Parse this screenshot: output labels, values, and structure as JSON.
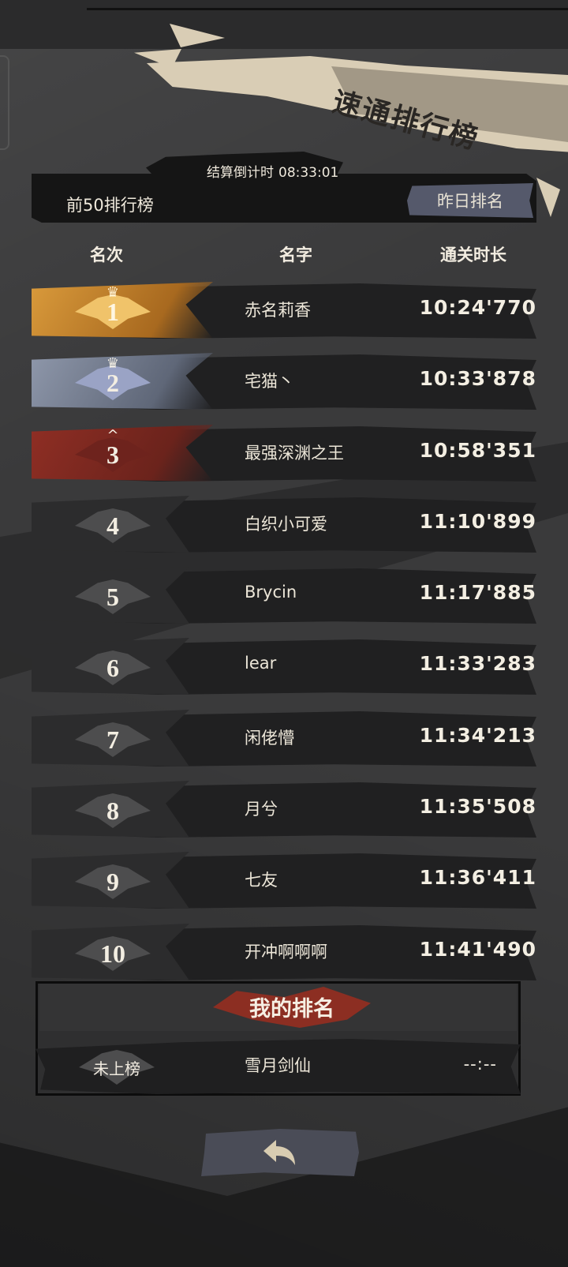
{
  "title": "速通排行榜",
  "countdown": {
    "label": "结算倒计时",
    "time": "08:33:01"
  },
  "board_label": "前50排行榜",
  "yesterday_button": "昨日排名",
  "columns": {
    "rank": "名次",
    "name": "名字",
    "time": "通关时长"
  },
  "entries": [
    {
      "rank": "1",
      "name": "赤名莉香",
      "time": "10:24'770",
      "tier": "gold"
    },
    {
      "rank": "2",
      "name": "宅猫丶",
      "time": "10:33'878",
      "tier": "silver"
    },
    {
      "rank": "3",
      "name": "最强深渊之王",
      "time": "10:58'351",
      "tier": "bronze"
    },
    {
      "rank": "4",
      "name": "白织小可爱",
      "time": "11:10'899",
      "tier": "normal"
    },
    {
      "rank": "5",
      "name": "Brycin",
      "time": "11:17'885",
      "tier": "normal"
    },
    {
      "rank": "6",
      "name": "lear",
      "time": "11:33'283",
      "tier": "normal"
    },
    {
      "rank": "7",
      "name": "闲佬懵",
      "time": "11:34'213",
      "tier": "normal"
    },
    {
      "rank": "8",
      "name": "月兮",
      "time": "11:35'508",
      "tier": "normal"
    },
    {
      "rank": "9",
      "name": "七友",
      "time": "11:36'411",
      "tier": "normal"
    },
    {
      "rank": "10",
      "name": "开冲啊啊啊",
      "time": "11:41'490",
      "tier": "normal"
    }
  ],
  "my_rank": {
    "title": "我的排名",
    "rank": "未上榜",
    "name": "雪月剑仙",
    "time": "--:--"
  },
  "icons": {
    "back": "back-arrow-icon",
    "crown": "crown-icon"
  },
  "colors": {
    "gold": "#f0c36a",
    "silver": "#9aa3c5",
    "bronze": "#8f2e24",
    "accent_red": "#8c2e22",
    "button": "#55596b"
  }
}
